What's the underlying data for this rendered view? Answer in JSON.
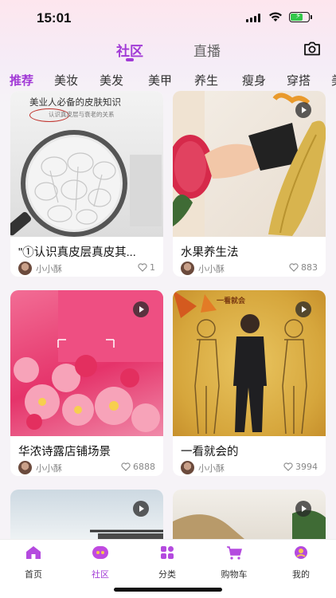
{
  "status_bar": {
    "time": "15:01"
  },
  "header": {
    "tabs": [
      {
        "label": "社区",
        "active": true
      },
      {
        "label": "直播",
        "active": false
      }
    ],
    "camera_icon": "camera-icon"
  },
  "categories": [
    "推荐",
    "美妆",
    "美发",
    "美甲",
    "养生",
    "瘦身",
    "穿搭",
    "美"
  ],
  "colors": {
    "accent": "#a23bd6",
    "background": "#f6f3f7"
  },
  "feed": [
    {
      "title": "\"①认识真皮层真皮其...",
      "author": "小小酥",
      "likes": "1",
      "is_video": false,
      "image_text": {
        "headline": "美业人必备的皮肤知识",
        "subline": "认识真皮层与衰老的关系"
      }
    },
    {
      "title": "水果养生法",
      "author": "小小酥",
      "likes": "883",
      "is_video": true
    },
    {
      "title": "华浓诗露店铺场景",
      "author": "小小酥",
      "likes": "6888",
      "is_video": true
    },
    {
      "title": "一看就会的",
      "author": "小小酥",
      "likes": "3994",
      "is_video": true,
      "image_text": {
        "headline": "一看就会"
      }
    },
    {
      "title": "",
      "author": "",
      "likes": "",
      "is_video": true
    },
    {
      "title": "",
      "author": "",
      "likes": "",
      "is_video": true
    }
  ],
  "bottom_nav": [
    {
      "label": "首页",
      "icon": "home-icon",
      "active": false
    },
    {
      "label": "社区",
      "icon": "community-icon",
      "active": true
    },
    {
      "label": "分类",
      "icon": "category-icon",
      "active": false
    },
    {
      "label": "购物车",
      "icon": "cart-icon",
      "active": false
    },
    {
      "label": "我的",
      "icon": "profile-icon",
      "active": false
    }
  ]
}
